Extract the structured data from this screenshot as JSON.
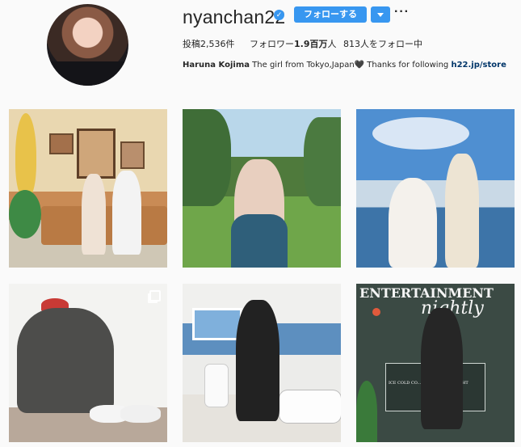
{
  "profile": {
    "username": "nyanchan22",
    "verified_icon": "verified-badge-icon",
    "follow_label": "フォローする",
    "more_label": "···",
    "stats": {
      "posts": "投稿2,536件",
      "followers_prefix": "フォロワー",
      "followers_value": "1.9百万",
      "followers_suffix": "人",
      "following": "813人をフォロー中"
    },
    "bio": {
      "name": "Haruna Kojima",
      "text": "The girl from Tokyo,Japan🖤 Thanks for following",
      "link": "h22.jp/store"
    }
  },
  "posts": [
    {
      "id": "post-1"
    },
    {
      "id": "post-2"
    },
    {
      "id": "post-3"
    },
    {
      "id": "post-4",
      "multi": true
    },
    {
      "id": "post-5"
    },
    {
      "id": "post-6",
      "sign_line1": "ENTERTAINMENT",
      "sign_line2": "nightly",
      "sign_small": "ICE COLD CO... CALVIN KLEIN ...GHT"
    }
  ],
  "colors": {
    "accent": "#3897f0",
    "background": "#fafafa",
    "text": "#262626",
    "link": "#003569"
  }
}
